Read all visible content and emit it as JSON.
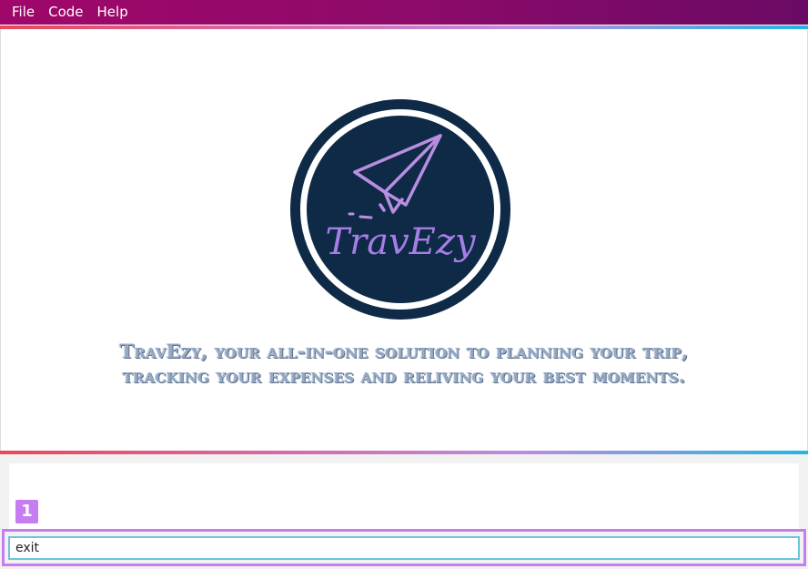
{
  "menu": {
    "file": "File",
    "code": "Code",
    "help": "Help"
  },
  "logo": {
    "brand_text": "TravEzy",
    "ring_color": "#0e2a47",
    "accent_colors": [
      "#b98ee0",
      "#5a8de8"
    ]
  },
  "tagline": {
    "line1": "TravEzy, your all-in-one solution to planning your trip,",
    "line2": "tracking your expenses and reliving your best moments."
  },
  "annotation": {
    "badge_number": "1",
    "highlight_color": "#c77df2"
  },
  "command": {
    "value": "exit"
  },
  "colors": {
    "menubar": "#8e0a6a",
    "gradient_start": "#e8495a",
    "gradient_end": "#22b7e0",
    "input_border": "#6bc4e0"
  }
}
